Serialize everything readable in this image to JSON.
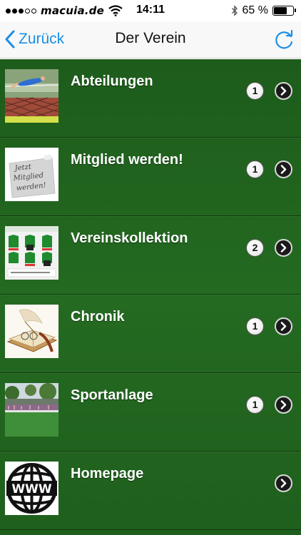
{
  "status_bar": {
    "carrier": "macuia.de",
    "time": "14:11",
    "battery_percent_label": "65 %",
    "battery_level": 0.65,
    "signal_dots_filled": 3,
    "signal_dots_total": 5
  },
  "nav": {
    "back_label": "Zurück",
    "title": "Der Verein",
    "accent_color": "#1a8fe6"
  },
  "items": [
    {
      "label": "Abteilungen",
      "badge": "1",
      "thumb_icon": "high-jump-photo-icon"
    },
    {
      "label": "Mitglied werden!",
      "badge": "1",
      "thumb_icon": "membership-note-icon"
    },
    {
      "label": "Vereinskollektion",
      "badge": "2",
      "thumb_icon": "jersey-catalog-icon"
    },
    {
      "label": "Chronik",
      "badge": "1",
      "thumb_icon": "old-book-quill-icon"
    },
    {
      "label": "Sportanlage",
      "badge": "1",
      "thumb_icon": "sports-field-photo-icon"
    },
    {
      "label": "Homepage",
      "badge": "",
      "thumb_icon": "www-globe-icon"
    }
  ],
  "thumb_texts": {
    "membership_note": [
      "Jetzt",
      "Mitglied",
      "werden!"
    ],
    "globe": "WWW"
  },
  "colors": {
    "list_green": "#246a21",
    "text_white": "#ffffff"
  }
}
